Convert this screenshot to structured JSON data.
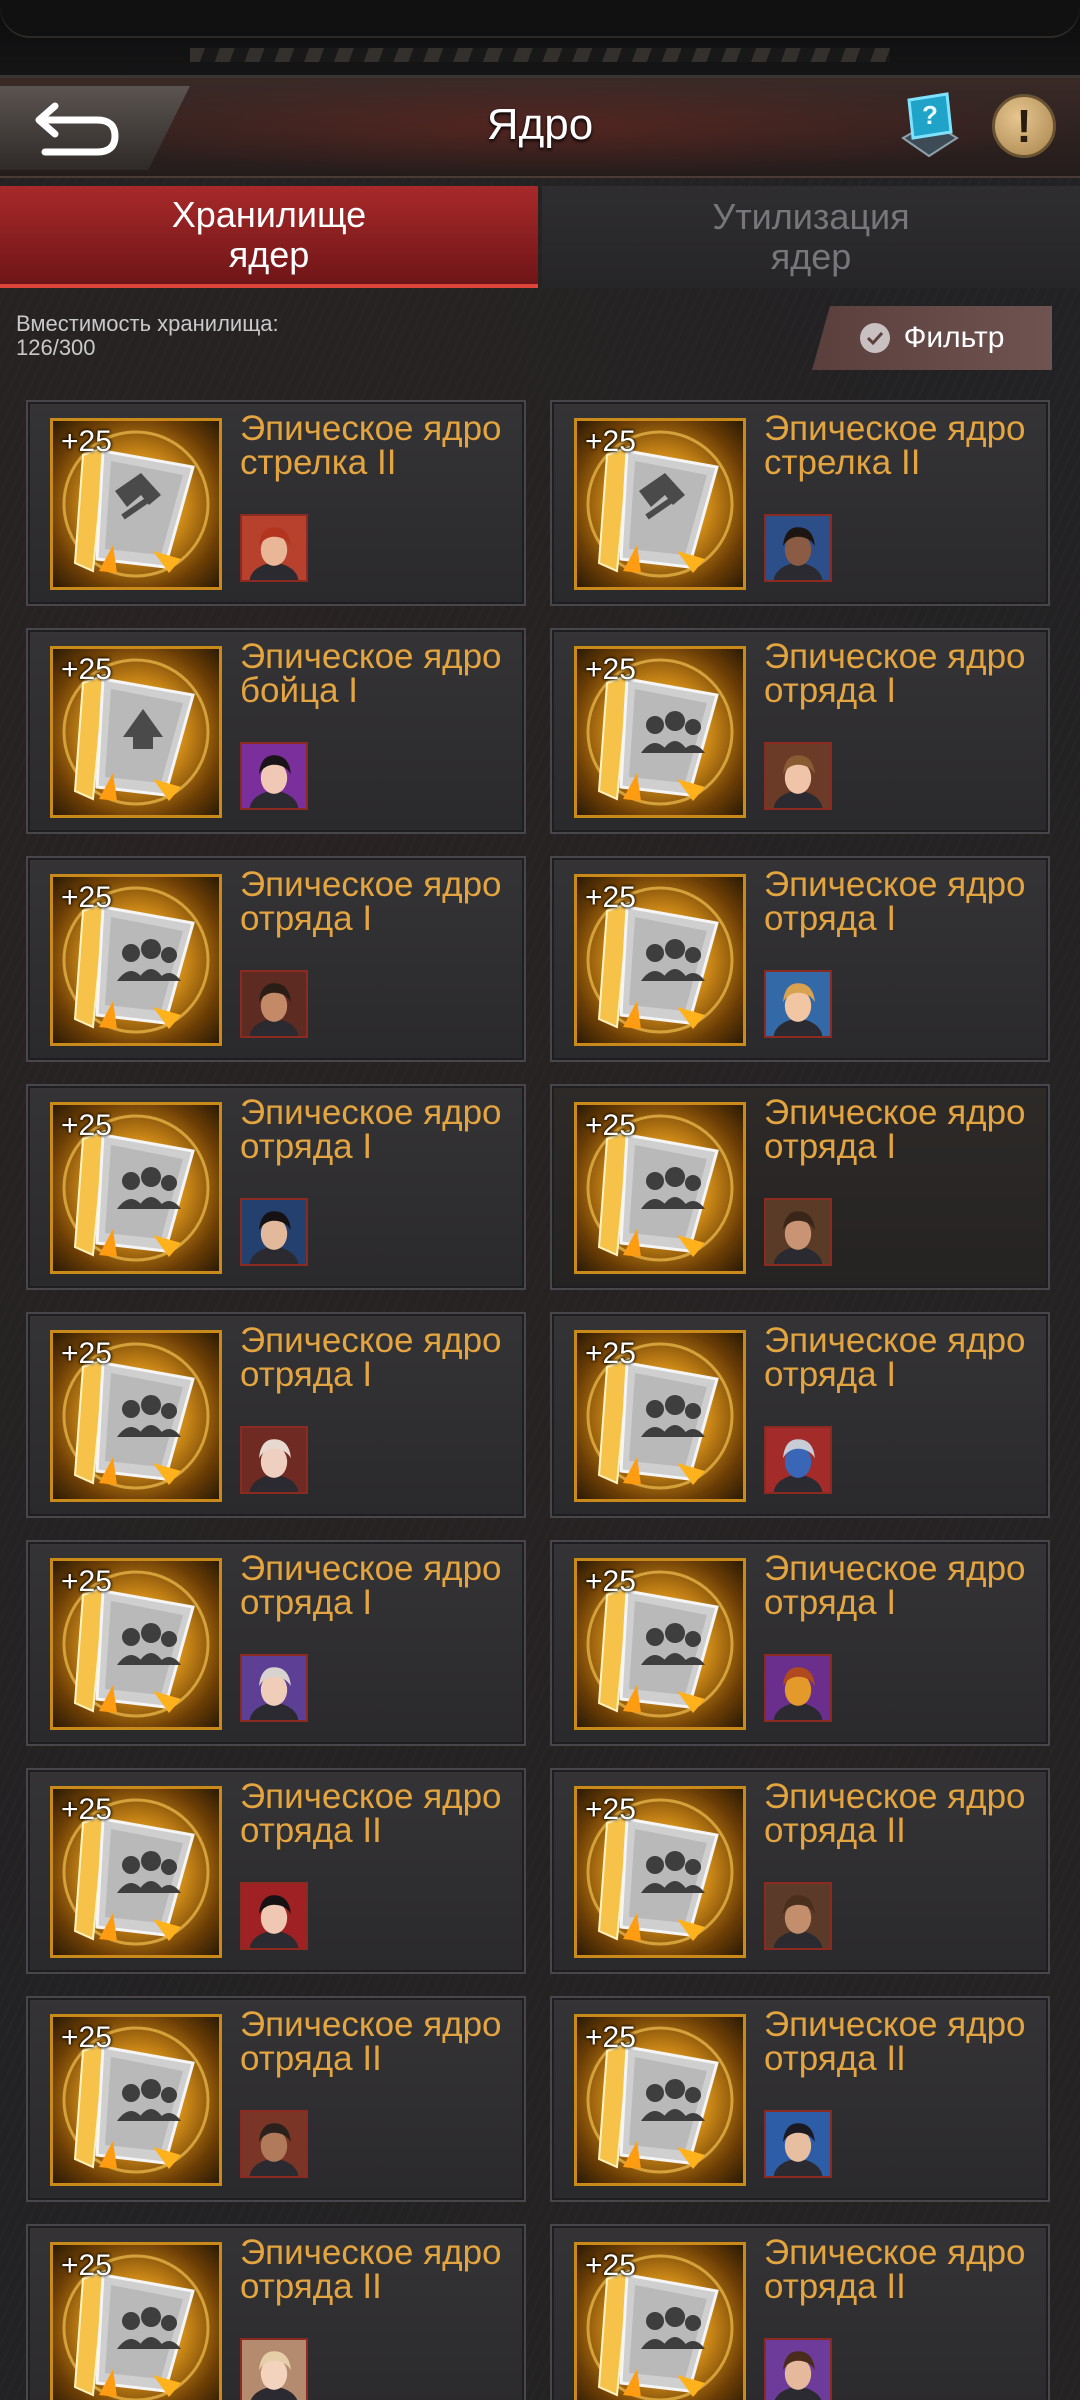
{
  "header": {
    "title": "Ядро",
    "back_icon": "back-arrow-icon",
    "help_icon": "help-screen-icon",
    "info_icon": "exclamation-icon",
    "info_symbol": "!"
  },
  "tabs": [
    {
      "label": "Хранилище\nядер",
      "active": true
    },
    {
      "label": "Утилизация\nядер",
      "active": false
    }
  ],
  "storage": {
    "label": "Вместимость хранилища:",
    "value": "126/300"
  },
  "filter": {
    "label": "Фильтр",
    "icon": "check-icon"
  },
  "colors": {
    "accent_red": "#a8292a",
    "name_orange": "#e4a540",
    "core_gold": "#e29a1c"
  },
  "cores": [
    {
      "level": "+25",
      "name_line1": "Эпическое ядро",
      "name_line2": "стрелка II",
      "emblem": "shooter",
      "avatar_bg": "#b8412e",
      "avatar_skin": "#e9b698",
      "avatar_hair": "#b4351f"
    },
    {
      "level": "+25",
      "name_line1": "Эпическое ядро",
      "name_line2": "стрелка II",
      "emblem": "shooter",
      "avatar_bg": "#2c4f8a",
      "avatar_skin": "#8b5c43",
      "avatar_hair": "#1d1512"
    },
    {
      "level": "+25",
      "name_line1": "Эпическое ядро",
      "name_line2": "бойца I",
      "emblem": "fighter",
      "avatar_bg": "#7b2f9c",
      "avatar_skin": "#f1c8b5",
      "avatar_hair": "#1a1418"
    },
    {
      "level": "+25",
      "name_line1": "Эпическое ядро",
      "name_line2": "отряда I",
      "emblem": "squad",
      "avatar_bg": "#6b3b27",
      "avatar_skin": "#f0c4a9",
      "avatar_hair": "#8a5a33"
    },
    {
      "level": "+25",
      "name_line1": "Эпическое ядро",
      "name_line2": "отряда I",
      "emblem": "squad",
      "avatar_bg": "#5e2b22",
      "avatar_skin": "#c48a68",
      "avatar_hair": "#2a1d16"
    },
    {
      "level": "+25",
      "name_line1": "Эпическое ядро",
      "name_line2": "отряда I",
      "emblem": "squad",
      "avatar_bg": "#3469a8",
      "avatar_skin": "#f2c6a2",
      "avatar_hair": "#d8a24e"
    },
    {
      "level": "+25",
      "name_line1": "Эпическое ядро",
      "name_line2": "отряда I",
      "emblem": "squad",
      "avatar_bg": "#24406e",
      "avatar_skin": "#e3b99b",
      "avatar_hair": "#161214"
    },
    {
      "level": "+25",
      "name_line1": "Эпическое ядро",
      "name_line2": "отряда I",
      "emblem": "squad",
      "avatar_bg": "#5a3b28",
      "avatar_skin": "#c99474",
      "avatar_hair": "#3a2618",
      "dim": true
    },
    {
      "level": "+25",
      "name_line1": "Эпическое ядро",
      "name_line2": "отряда I",
      "emblem": "squad",
      "avatar_bg": "#6f2b23",
      "avatar_skin": "#efcfbf",
      "avatar_hair": "#e8d9d0"
    },
    {
      "level": "+25",
      "name_line1": "Эпическое ядро",
      "name_line2": "отряда I",
      "emblem": "squad",
      "avatar_bg": "#a32c2a",
      "avatar_skin": "#3a66b8",
      "avatar_hair": "#c7ccd6"
    },
    {
      "level": "+25",
      "name_line1": "Эпическое ядро",
      "name_line2": "отряда I",
      "emblem": "squad",
      "avatar_bg": "#5e3f96",
      "avatar_skin": "#f0cdb8",
      "avatar_hair": "#d9d3cf"
    },
    {
      "level": "+25",
      "name_line1": "Эпическое ядро",
      "name_line2": "отряда I",
      "emblem": "squad",
      "avatar_bg": "#6a2f8c",
      "avatar_skin": "#e39a2a",
      "avatar_hair": "#b04a1e"
    },
    {
      "level": "+25",
      "name_line1": "Эпическое ядро",
      "name_line2": "отряда II",
      "emblem": "squad",
      "avatar_bg": "#a02123",
      "avatar_skin": "#f0c7b2",
      "avatar_hair": "#161214"
    },
    {
      "level": "+25",
      "name_line1": "Эпическое ядро",
      "name_line2": "отряда II",
      "emblem": "squad",
      "avatar_bg": "#5b3a2a",
      "avatar_skin": "#c38e6b",
      "avatar_hair": "#4a2f1c"
    },
    {
      "level": "+25",
      "name_line1": "Эпическое ядро",
      "name_line2": "отряда II",
      "emblem": "squad",
      "avatar_bg": "#7a3526",
      "avatar_skin": "#b07a5b",
      "avatar_hair": "#2b211c"
    },
    {
      "level": "+25",
      "name_line1": "Эпическое ядро",
      "name_line2": "отряда II",
      "emblem": "squad",
      "avatar_bg": "#2e5da8",
      "avatar_skin": "#e8bea1",
      "avatar_hair": "#1b1a22"
    },
    {
      "level": "+25",
      "name_line1": "Эпическое ядро",
      "name_line2": "отряда II",
      "emblem": "squad",
      "avatar_bg": "#b58b70",
      "avatar_skin": "#f3d3bd",
      "avatar_hair": "#e6cfa8"
    },
    {
      "level": "+25",
      "name_line1": "Эпическое ядро",
      "name_line2": "отряда II",
      "emblem": "squad",
      "avatar_bg": "#6d3b9a",
      "avatar_skin": "#e7b99c",
      "avatar_hair": "#4a2c1c"
    }
  ]
}
